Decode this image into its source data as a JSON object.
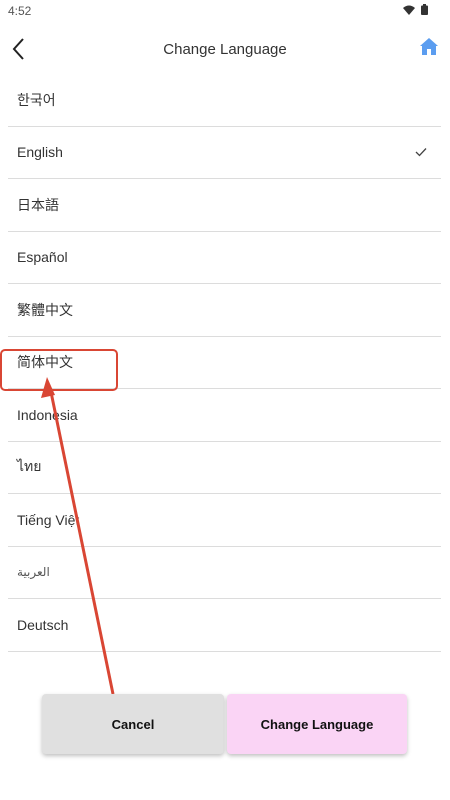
{
  "status_bar": {
    "time": "4:52",
    "wifi_icon": "wifi-icon",
    "battery_icon": "battery-icon"
  },
  "app_bar": {
    "title": "Change Language",
    "back_icon": "back-arrow-icon",
    "home_icon": "home-icon",
    "home_color": "#5b9df0"
  },
  "languages": [
    {
      "label": "한국어",
      "selected": false
    },
    {
      "label": "English",
      "selected": true
    },
    {
      "label": "日本語",
      "selected": false
    },
    {
      "label": "Español",
      "selected": false
    },
    {
      "label": "繁體中文",
      "selected": false
    },
    {
      "label": "简体中文",
      "selected": false
    },
    {
      "label": "Indonesia",
      "selected": false
    },
    {
      "label": "ไทย",
      "selected": false
    },
    {
      "label": "Tiếng Việt",
      "selected": false
    },
    {
      "label": "العربية",
      "selected": false
    },
    {
      "label": "Deutsch",
      "selected": false
    }
  ],
  "buttons": {
    "cancel": "Cancel",
    "change": "Change Language"
  },
  "colors": {
    "annotation": "#d94634",
    "cancel_bg": "#e0e0e0",
    "change_bg": "#fad4f5",
    "divider": "#dcdcdc"
  }
}
